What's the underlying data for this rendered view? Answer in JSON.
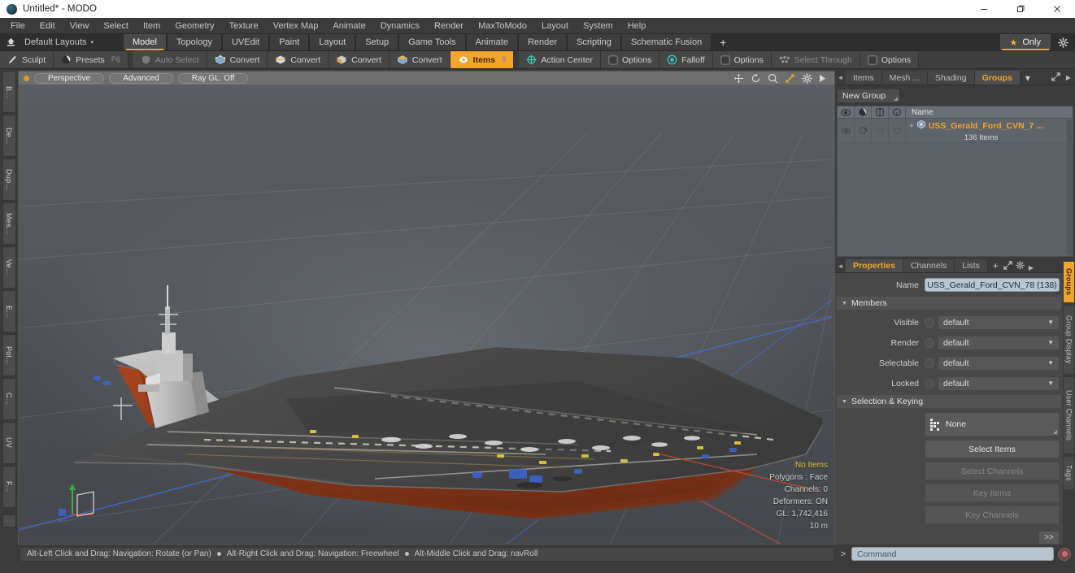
{
  "window": {
    "title": "Untitled* - MODO",
    "app_icon": "modo-orb-icon",
    "minimize": "minimize-icon",
    "maximize": "restore-icon",
    "close": "close-icon"
  },
  "menubar": {
    "items": [
      "File",
      "Edit",
      "View",
      "Select",
      "Item",
      "Geometry",
      "Texture",
      "Vertex Map",
      "Animate",
      "Dynamics",
      "Render",
      "MaxToModo",
      "Layout",
      "System",
      "Help"
    ]
  },
  "layoutbar": {
    "home_icon": "layout-home-icon",
    "preset_label": "Default Layouts",
    "caret": "▾",
    "tabs": [
      {
        "label": "Model",
        "active": true
      },
      {
        "label": "Topology",
        "active": false
      },
      {
        "label": "UVEdit",
        "active": false
      },
      {
        "label": "Paint",
        "active": false
      },
      {
        "label": "Layout",
        "active": false
      },
      {
        "label": "Setup",
        "active": false
      },
      {
        "label": "Game Tools",
        "active": false
      },
      {
        "label": "Animate",
        "active": false
      },
      {
        "label": "Render",
        "active": false
      },
      {
        "label": "Scripting",
        "active": false
      },
      {
        "label": "Schematic Fusion",
        "active": false
      }
    ],
    "add_tab": "+",
    "only_label": "Only",
    "only_star": "★",
    "gear": "gear-icon",
    "accent": "#e8a33d"
  },
  "modebar": {
    "groups": [
      {
        "label": "Sculpt",
        "icon": "brush-icon",
        "state": "normal",
        "key": ""
      },
      {
        "label": "Presets",
        "icon": "sphere-icon",
        "state": "normal",
        "key": "F6"
      },
      {
        "label": "Auto Select",
        "icon": "shield-icon",
        "state": "dim",
        "key": ""
      },
      {
        "label": "Convert",
        "icon": "vertex-cube-icon",
        "state": "normal",
        "key": ""
      },
      {
        "label": "Convert",
        "icon": "edge-cube-icon",
        "state": "normal",
        "key": ""
      },
      {
        "label": "Convert",
        "icon": "polygon-cube-icon",
        "state": "normal",
        "key": ""
      },
      {
        "label": "Convert",
        "icon": "material-cube-icon",
        "state": "normal",
        "key": ""
      },
      {
        "label": "Items",
        "icon": "items-cube-icon",
        "state": "on",
        "key": "5"
      },
      {
        "label": "Action Center",
        "icon": "target-icon",
        "state": "normal",
        "key": ""
      },
      {
        "label": "Options",
        "icon": "checkbox-icon",
        "state": "normal",
        "key": ""
      },
      {
        "label": "Falloff",
        "icon": "falloff-icon",
        "state": "normal",
        "key": ""
      },
      {
        "label": "Options",
        "icon": "checkbox-icon",
        "state": "normal",
        "key": ""
      },
      {
        "label": "Select Through",
        "icon": "select-through-icon",
        "state": "dim",
        "key": ""
      },
      {
        "label": "Options",
        "icon": "checkbox-icon",
        "state": "normal",
        "key": ""
      }
    ]
  },
  "left_tabs": [
    "B...",
    "De...",
    "Dup...",
    "Mes...",
    "Ve...",
    "E...",
    "Pol...",
    "C...",
    "UV",
    "F..."
  ],
  "viewport": {
    "header": {
      "dot": "viewport-menu-dot",
      "pills": [
        "Perspective",
        "Advanced",
        "Ray GL: Off"
      ],
      "icons": [
        "move-icon",
        "rotate-icon",
        "zoom-icon",
        "fit-icon",
        "gear-icon",
        "play-icon"
      ]
    },
    "stats": {
      "selection": "No Items",
      "polygons": "Polygons : Face",
      "channels": "Channels: 0",
      "deformers": "Deformers: ON",
      "gl": "GL: 1,742,416",
      "scale": "10 m"
    },
    "axis_gizmo": "axis-gizmo-icon",
    "model_name": "USS Gerald R. Ford CVN-78 aircraft carrier"
  },
  "right_panel": {
    "top_tabs": [
      {
        "label": "Items",
        "active": false
      },
      {
        "label": "Mesh ...",
        "active": false
      },
      {
        "label": "Shading",
        "active": false
      },
      {
        "label": "Groups",
        "active": true
      }
    ],
    "top_tab_caret": "▾",
    "popout_icon": "popout-icon",
    "arrow_icon": "chevron-right-icon",
    "new_group_button": "New Group",
    "tree": {
      "columns": [
        "eye-icon",
        "render-icon",
        "wireframe-icon",
        "shaded-icon"
      ],
      "name_header": "Name",
      "rows": [
        {
          "expand": "+",
          "icon": "group-item-icon",
          "label": "USS_Gerald_Ford_CVN_7 ...",
          "subtitle": "136 Items"
        }
      ]
    },
    "properties": {
      "tabs": [
        {
          "label": "Properties",
          "active": true
        },
        {
          "label": "Channels",
          "active": false
        },
        {
          "label": "Lists",
          "active": false
        }
      ],
      "add_tab": "+",
      "name_label": "Name",
      "name_value": "USS_Gerald_Ford_CVN_78 (138)",
      "sections": [
        {
          "title": "Members",
          "rows": [
            {
              "label": "Visible",
              "value": "default"
            },
            {
              "label": "Render",
              "value": "default"
            },
            {
              "label": "Selectable",
              "value": "default"
            },
            {
              "label": "Locked",
              "value": "default"
            }
          ]
        }
      ],
      "selection_keying": {
        "title": "Selection & Keying",
        "none_button": "None",
        "buttons": [
          {
            "label": "Select Items",
            "disabled": false
          },
          {
            "label": "Select Channels",
            "disabled": true
          },
          {
            "label": "Key Items",
            "disabled": true
          },
          {
            "label": "Key Channels",
            "disabled": true
          }
        ],
        "more_button": ">>"
      }
    },
    "side_tabs": [
      {
        "label": "Groups",
        "active": true
      },
      {
        "label": "Group Display",
        "active": false
      },
      {
        "label": "User Channels",
        "active": false
      },
      {
        "label": "Tags",
        "active": false
      }
    ]
  },
  "statusbar": {
    "hints": [
      "Alt-Left Click and Drag: Navigation: Rotate (or Pan)",
      "Alt-Right Click and Drag: Navigation: Freewheel",
      "Alt-Middle Click and Drag: navRoll"
    ],
    "command_prompt": ">",
    "command_placeholder": "Command",
    "record_button": "record-icon"
  }
}
